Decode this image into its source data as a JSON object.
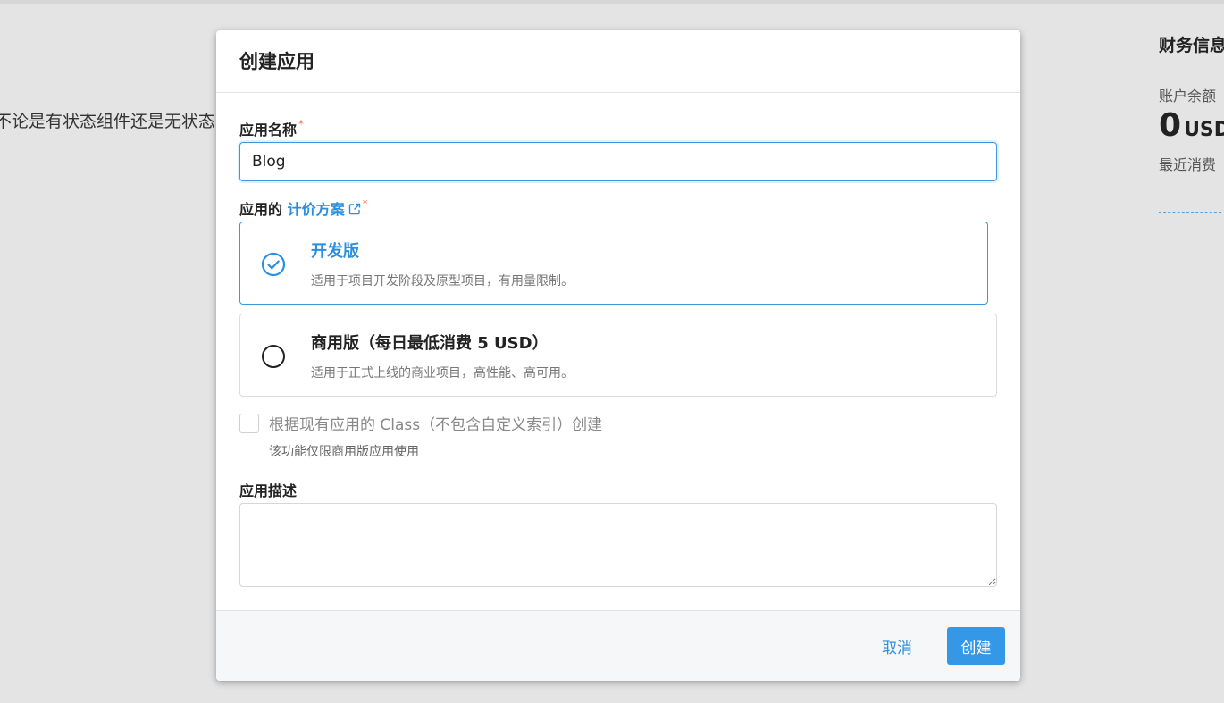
{
  "background": {
    "snippet_text": "不论是有状态组件还是无状态",
    "finance": {
      "title": "财务信息",
      "balance_label": "账户余额",
      "balance_value": "0",
      "balance_currency": "USD",
      "recent_label": "最近消费"
    }
  },
  "modal": {
    "title": "创建应用",
    "name_field": {
      "label": "应用名称",
      "required_mark": "*",
      "value": "Blog"
    },
    "plan_field": {
      "label_prefix": "应用的",
      "label_link": "计价方案",
      "link_icon": "external-link-icon",
      "required_mark": "*"
    },
    "plans": [
      {
        "title": "开发版",
        "description": "适用于项目开发阶段及原型项目，有用量限制。",
        "selected": true,
        "icon": "check-circle-icon"
      },
      {
        "title": "商用版（每日最低消费 5 USD）",
        "description": "适用于正式上线的商业项目，高性能、高可用。",
        "selected": false,
        "icon": "radio-circle-icon"
      }
    ],
    "class_option": {
      "label": "根据现有应用的 Class（不包含自定义索引）创建",
      "hint": "该功能仅限商用版应用使用",
      "checked": false,
      "disabled": true
    },
    "description_field": {
      "label": "应用描述",
      "value": ""
    },
    "footer": {
      "cancel_label": "取消",
      "create_label": "创建"
    }
  },
  "colors": {
    "accent": "#3498e6",
    "link": "#2a8fde",
    "required": "#e07a5f",
    "backdrop": "#e4e4e4"
  }
}
